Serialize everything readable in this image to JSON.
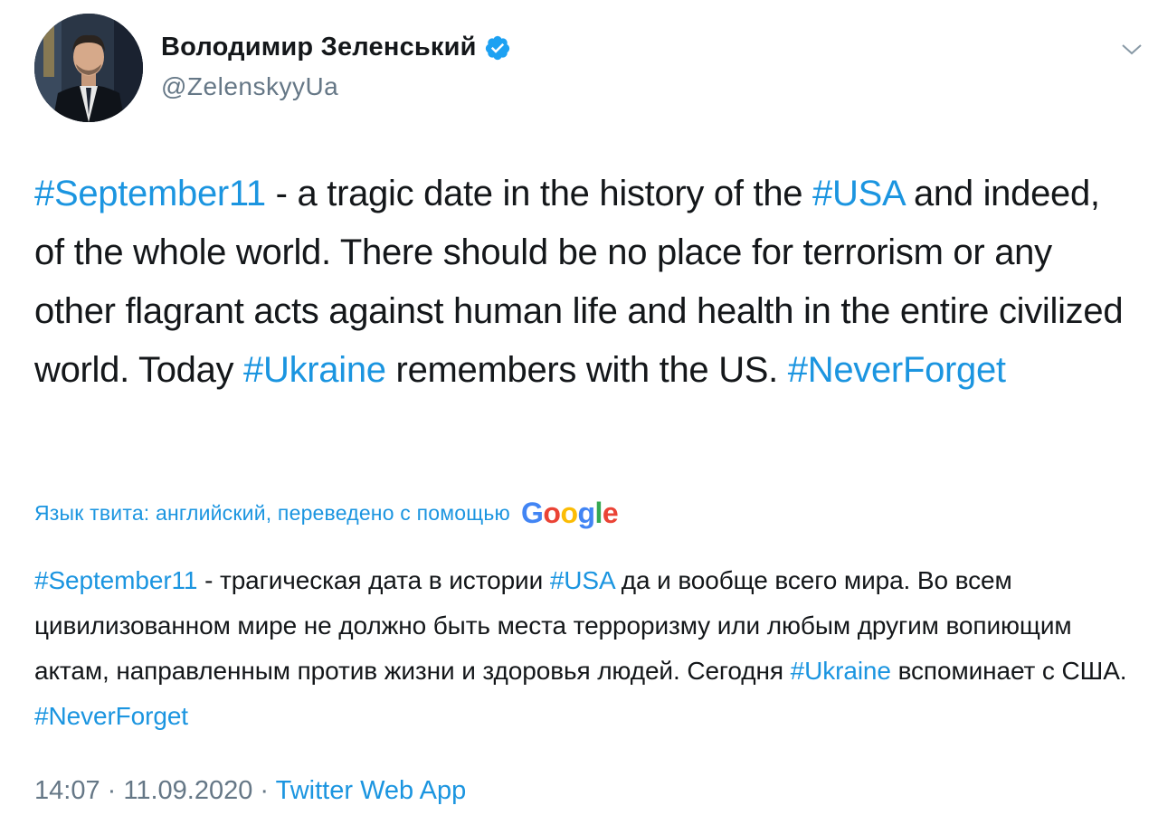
{
  "author": {
    "name": "Володимир Зеленський",
    "handle": "@ZelenskyyUa"
  },
  "tweet": {
    "segments": [
      {
        "text": "#September11",
        "tag": true
      },
      {
        "text": " - a tragic date in the history of the ",
        "tag": false
      },
      {
        "text": "#USA",
        "tag": true
      },
      {
        "text": " and indeed, of the whole world. There should be no place for terrorism or any other flagrant acts against human life and health in the entire civilized world. Today ",
        "tag": false
      },
      {
        "text": "#Ukraine",
        "tag": true
      },
      {
        "text": " remembers with the US. ",
        "tag": false
      },
      {
        "text": "#NeverForget",
        "tag": true
      }
    ]
  },
  "translation": {
    "label": "Язык твита: английский, переведено с помощью",
    "provider": "Google",
    "segments": [
      {
        "text": "#September11",
        "tag": true
      },
      {
        "text": " - трагическая дата в истории ",
        "tag": false
      },
      {
        "text": "#USA",
        "tag": true
      },
      {
        "text": " да и вообще всего мира. Во всем цивилизованном мире не должно быть места терроризму или любым другим вопиющим актам, направленным против жизни и здоровья людей. Сегодня ",
        "tag": false
      },
      {
        "text": "#Ukraine",
        "tag": true
      },
      {
        "text": " вспоминает с США. ",
        "tag": false
      },
      {
        "text": "#NeverForget",
        "tag": true
      }
    ]
  },
  "meta": {
    "time": "14:07",
    "separator1": " · ",
    "date": "11.09.2020",
    "separator2": " · ",
    "source": "Twitter Web App"
  },
  "icons": {
    "verified": "verified-badge-icon",
    "caret": "chevron-down-icon"
  },
  "colors": {
    "link": "#1b95e0",
    "secondary": "#657786",
    "text": "#14171a"
  }
}
